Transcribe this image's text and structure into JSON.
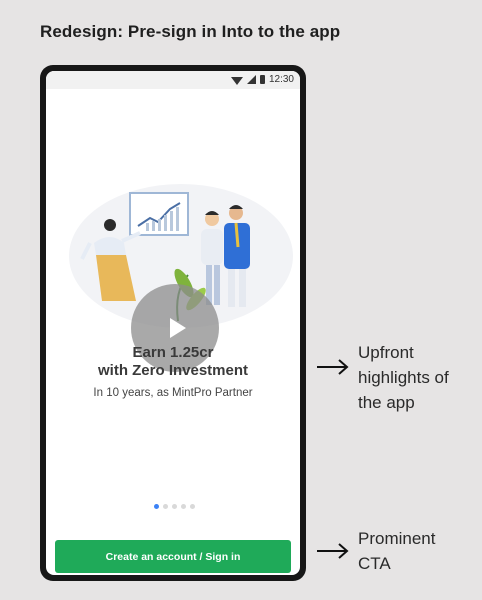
{
  "heading": "Redesign: Pre-sign in Into to the app",
  "status_bar": {
    "time": "12:30",
    "icons": [
      "wifi-icon",
      "signal-icon",
      "battery-icon"
    ]
  },
  "slide": {
    "headline_line1": "Earn 1.25cr",
    "headline_line2": "with Zero Investment",
    "subtext": "In 10 years, as MintPro Partner"
  },
  "carousel": {
    "total_dots": 5,
    "active_index": 0
  },
  "cta_label": "Create an account / Sign in",
  "annotations": {
    "highlights": [
      "Upfront",
      "highlights of",
      "the app"
    ],
    "cta": [
      "Prominent",
      "CTA"
    ]
  },
  "colors": {
    "cta": "#1faa59",
    "active_dot": "#3b82f6",
    "frame": "#171717"
  }
}
